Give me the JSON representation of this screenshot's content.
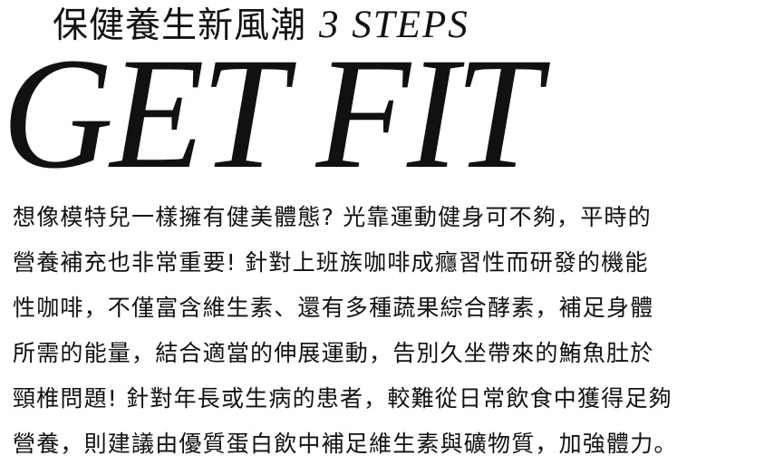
{
  "headline": {
    "chinese": "保健養生新風潮",
    "english": "3 STEPS"
  },
  "hero": {
    "title": "GET FIT"
  },
  "article": {
    "lines": [
      "想像模特兒一樣擁有健美體態? 光靠運動健身可不夠，平時的",
      "營養補充也非常重要! 針對上班族咖啡成癮習性而研發的機能",
      "性咖啡，不僅富含維生素、還有多種蔬果綜合酵素，補足身體",
      "所需的能量，結合適當的伸展運動，告別久坐帶來的鮪魚肚於",
      "頸椎問題! 針對年長或生病的患者，較難從日常飲食中獲得足夠",
      "營養，則建議由優質蛋白飲中補足維生素與礦物質，加強體力。"
    ]
  }
}
